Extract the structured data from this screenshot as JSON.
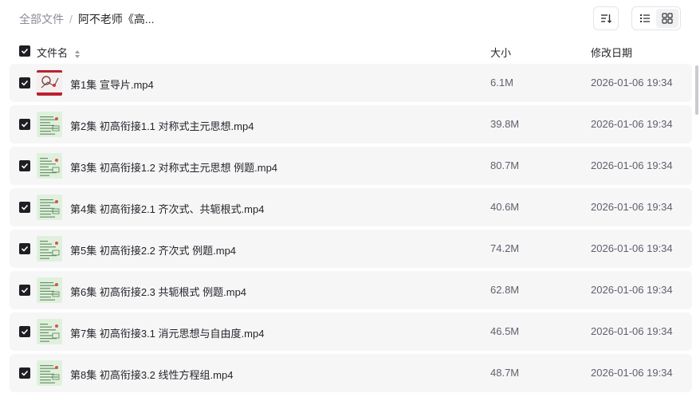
{
  "breadcrumb": {
    "root": "全部文件",
    "separator": "/",
    "current": "阿不老师《高..."
  },
  "toolbar": {
    "sort_icon": "sort-icon",
    "list_view_icon": "list-view-icon",
    "grid_view_icon": "grid-view-icon",
    "active_view": "list"
  },
  "columns": {
    "name": "文件名",
    "size": "大小",
    "date": "修改日期"
  },
  "select_all_checked": true,
  "colors": {
    "checkbox": "#1f1f23",
    "row_bg": "#f6f6f7",
    "text": "#25262b",
    "muted": "#5f626b"
  },
  "files": [
    {
      "name": "第1集 宣导片.mp4",
      "size": "6.1M",
      "date": "2026-01-06 19:34",
      "checked": true,
      "thumb": "red"
    },
    {
      "name": "第2集 初高衔接1.1 对称式主元思想.mp4",
      "size": "39.8M",
      "date": "2026-01-06 19:34",
      "checked": true,
      "thumb": "green"
    },
    {
      "name": "第3集 初高衔接1.2 对称式主元思想 例题.mp4",
      "size": "80.7M",
      "date": "2026-01-06 19:34",
      "checked": true,
      "thumb": "green"
    },
    {
      "name": "第4集 初高衔接2.1 齐次式、共轭根式.mp4",
      "size": "40.6M",
      "date": "2026-01-06 19:34",
      "checked": true,
      "thumb": "green"
    },
    {
      "name": "第5集 初高衔接2.2 齐次式 例题.mp4",
      "size": "74.2M",
      "date": "2026-01-06 19:34",
      "checked": true,
      "thumb": "green"
    },
    {
      "name": "第6集 初高衔接2.3 共轭根式 例题.mp4",
      "size": "62.8M",
      "date": "2026-01-06 19:34",
      "checked": true,
      "thumb": "green"
    },
    {
      "name": "第7集 初高衔接3.1 消元思想与自由度.mp4",
      "size": "46.5M",
      "date": "2026-01-06 19:34",
      "checked": true,
      "thumb": "green"
    },
    {
      "name": "第8集 初高衔接3.2 线性方程组.mp4",
      "size": "48.7M",
      "date": "2026-01-06 19:34",
      "checked": true,
      "thumb": "green"
    }
  ]
}
